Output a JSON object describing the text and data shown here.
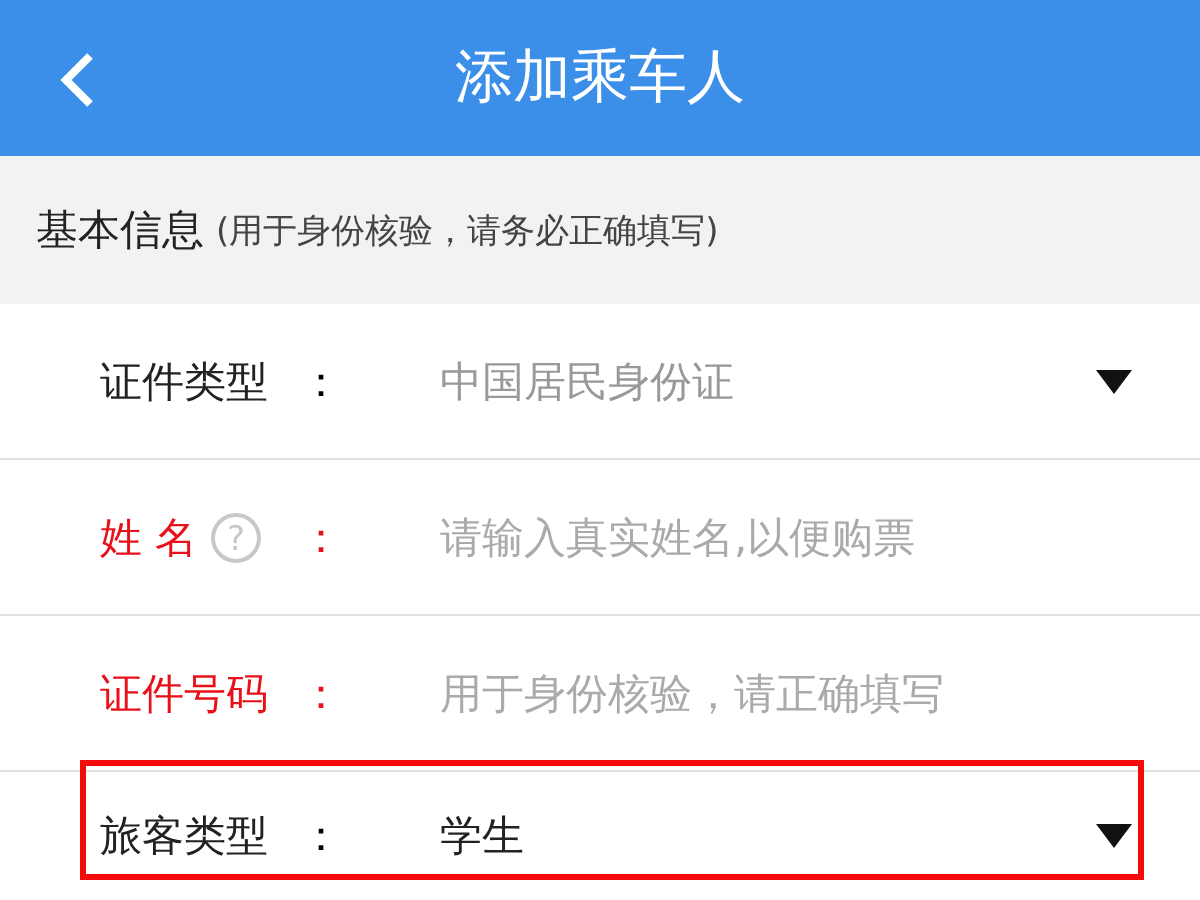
{
  "header": {
    "title": "添加乘车人"
  },
  "section": {
    "title": "基本信息",
    "note": "(用于身份核验，请务必正确填写)"
  },
  "rows": [
    {
      "kind": "select",
      "label": "证件类型",
      "colon": "：",
      "required": false,
      "help": false,
      "value": "中国居民身份证",
      "highlighted": false
    },
    {
      "kind": "input",
      "label": "姓 名",
      "colon": "：",
      "required": true,
      "help": true,
      "help_mark": "?",
      "placeholder": "请输入真实姓名,以便购票",
      "highlighted": false
    },
    {
      "kind": "input",
      "label": "证件号码",
      "colon": "：",
      "required": true,
      "help": false,
      "placeholder": "用于身份核验，请正确填写",
      "highlighted": false
    },
    {
      "kind": "select",
      "label": "旅客类型",
      "colon": "：",
      "required": false,
      "help": false,
      "value": "学生",
      "highlighted": true
    }
  ]
}
